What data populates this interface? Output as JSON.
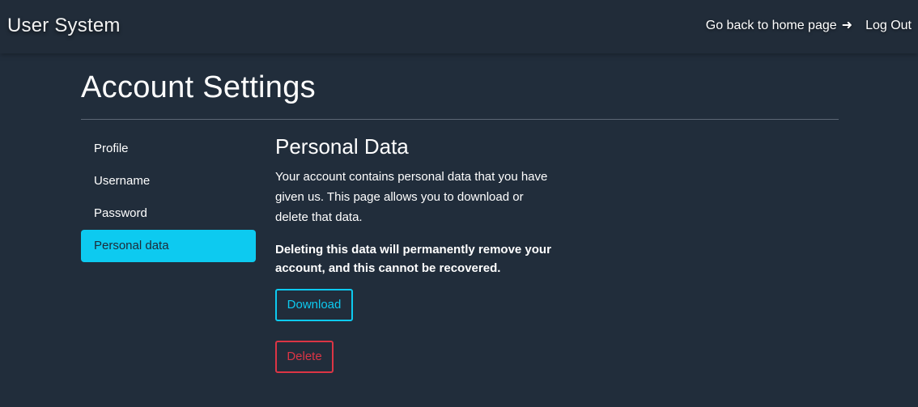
{
  "navbar": {
    "brand": "User System",
    "home_link": "Go back to home page",
    "home_link_icon": "arrow-right-icon",
    "logout_link": "Log Out"
  },
  "page": {
    "title": "Account Settings"
  },
  "sidebar": {
    "items": [
      {
        "label": "Profile",
        "active": false
      },
      {
        "label": "Username",
        "active": false
      },
      {
        "label": "Password",
        "active": false
      },
      {
        "label": "Personal data",
        "active": true
      }
    ]
  },
  "personal_data": {
    "heading": "Personal Data",
    "description": "Your account contains personal data that you have given us. This page allows you to download or delete that data.",
    "warning": "Deleting this data will permanently remove your account, and this cannot be recovered.",
    "download_label": "Download",
    "delete_label": "Delete"
  },
  "colors": {
    "background": "#212d3b",
    "accent": "#0dcaf0",
    "danger": "#dc3545",
    "divider": "#5c6775"
  }
}
